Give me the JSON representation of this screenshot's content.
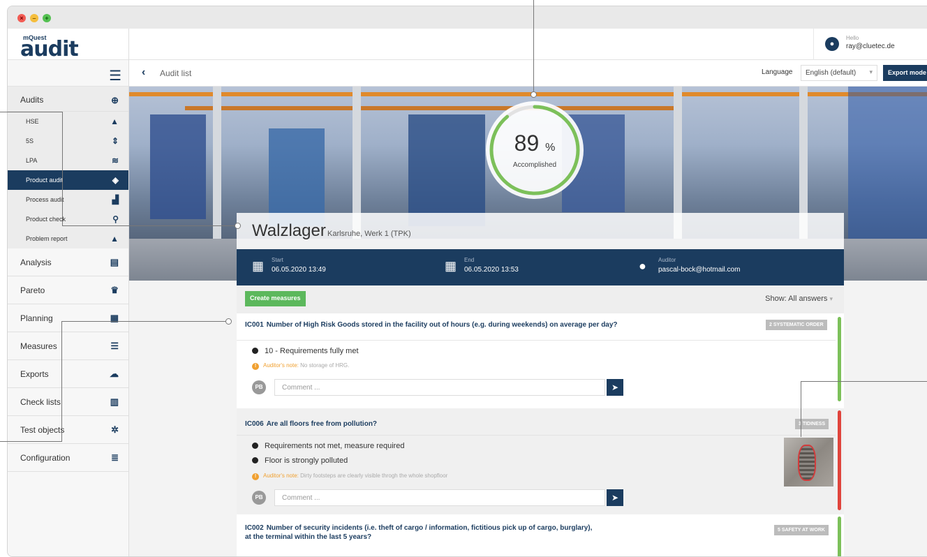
{
  "window": {
    "controls": [
      "close",
      "minimize",
      "maximize"
    ]
  },
  "logo": {
    "small": "mQuest",
    "big": "audit"
  },
  "sidebar": {
    "main_items": [
      {
        "label": "Audits",
        "icon": "globe-icon",
        "glyph": "⊕"
      },
      {
        "label": "Analysis",
        "icon": "chart-icon",
        "glyph": "▤"
      },
      {
        "label": "Pareto",
        "icon": "trophy-icon",
        "glyph": "♛"
      },
      {
        "label": "Planning",
        "icon": "calendar-icon",
        "glyph": "▦"
      },
      {
        "label": "Measures",
        "icon": "tasks-icon",
        "glyph": "☰"
      },
      {
        "label": "Exports",
        "icon": "cloud-upload-icon",
        "glyph": "☁"
      },
      {
        "label": "Check lists",
        "icon": "clipboard-icon",
        "glyph": "▥"
      },
      {
        "label": "Test objects",
        "icon": "cogs-icon",
        "glyph": "✲"
      },
      {
        "label": "Configuration",
        "icon": "database-icon",
        "glyph": "≣"
      }
    ],
    "sub_items": [
      {
        "label": "HSE",
        "icon": "helmet-icon",
        "glyph": "▲"
      },
      {
        "label": "5S",
        "icon": "sort-icon",
        "glyph": "⇕"
      },
      {
        "label": "LPA",
        "icon": "layers-icon",
        "glyph": "≋"
      },
      {
        "label": "Product audit",
        "icon": "box-icon",
        "glyph": "◈",
        "active": true
      },
      {
        "label": "Process audit",
        "icon": "factory-icon",
        "glyph": "▟"
      },
      {
        "label": "Product check",
        "icon": "magnifier-icon",
        "glyph": "⚲"
      },
      {
        "label": "Problem report",
        "icon": "warning-icon",
        "glyph": "▲"
      }
    ]
  },
  "header": {
    "hello": "Hello",
    "email": "ray@cluetec.de"
  },
  "toolbar": {
    "back_glyph": "‹",
    "breadcrumb": "Audit list",
    "language_label": "Language",
    "language_value": "English (default)",
    "export_label": "Export mode"
  },
  "hero": {
    "percent": "89",
    "percent_unit": "%",
    "percent_label": "Accomplished",
    "progress": 0.89
  },
  "audit": {
    "title": "Walzlager",
    "location": "Karlsruhe, Werk 1 (TPK)",
    "start_label": "Start",
    "start_value": "06.05.2020 13:49",
    "end_label": "End",
    "end_value": "06.05.2020 13:53",
    "auditor_label": "Auditor",
    "auditor_value": "pascal-bock@hotmail.com"
  },
  "filter": {
    "create_measures": "Create measures",
    "show": "Show: All answers"
  },
  "questions": [
    {
      "code": "IC001",
      "text": "Number of High Risk Goods stored in the facility out of hours (e.g. during weekends) on average per day?",
      "badge": "2 SYSTEMATIC ORDER",
      "status_color": "#7cc05a",
      "answers": [
        "10 - Requirements fully met"
      ],
      "note_key": "Auditor's note:",
      "note": "No storage of HRG.",
      "comment_placeholder": "Comment ...",
      "commenter": "PB"
    },
    {
      "code": "IC006",
      "text": "Are all floors free from pollution?",
      "badge": "3 TIDINESS",
      "status_color": "#e0443c",
      "answers": [
        "Requirements not met, measure required",
        "Floor is strongly polluted"
      ],
      "note_key": "Auditor's note:",
      "note": "Dirty footsteps are clearly visible throgh the whole shopfloor",
      "comment_placeholder": "Comment ...",
      "commenter": "PB"
    },
    {
      "code": "IC002",
      "text": "Number of security incidents (i.e. theft of cargo / information, fictitious pick up of cargo, burglary),",
      "text2": "at the terminal within the last 5 years?",
      "badge": "5 SAFETY AT WORK",
      "status_color": "#7cc05a"
    }
  ]
}
